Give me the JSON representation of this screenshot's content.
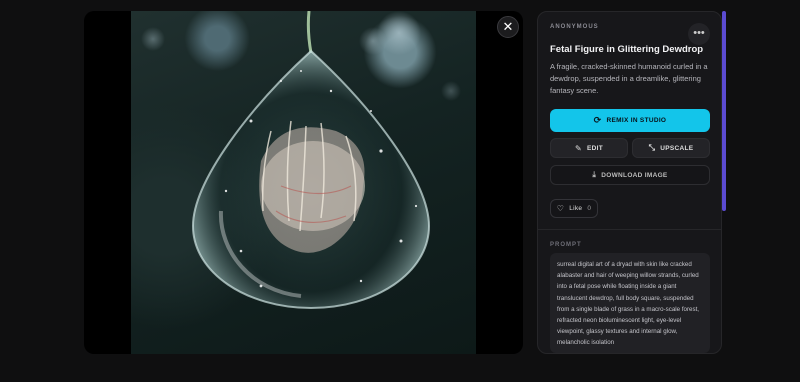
{
  "image": {
    "alt": "Fetal Figure in Glittering Dewdrop"
  },
  "close_icon": "close-icon",
  "panel": {
    "author": "ANONYMOUS",
    "more_icon": "more-icon",
    "title": "Fetal Figure in Glittering Dewdrop",
    "description": "A fragile, cracked-skinned humanoid curled in a dewdrop, suspended in a dreamlike, glittering fantasy scene.",
    "remix_label": "REMIX IN STUDIO",
    "edit_label": "EDIT",
    "upscale_label": "UPSCALE",
    "download_label": "DOWNLOAD IMAGE",
    "like_label": "Like",
    "like_count": "0",
    "prompt_label": "PROMPT",
    "prompt_text": "surreal digital art of a dryad with skin like cracked alabaster and hair of weeping willow strands, curled into a fetal pose while floating inside a giant translucent dewdrop, full body square, suspended from a single blade of grass in a macro-scale forest, refracted neon bioluminescent light, eye-level viewpoint, glassy textures and internal glow, melancholic isolation"
  },
  "colors": {
    "accent": "#13c5ea",
    "scrollbar": "#5b4bd1",
    "panel_bg": "#17171a"
  }
}
